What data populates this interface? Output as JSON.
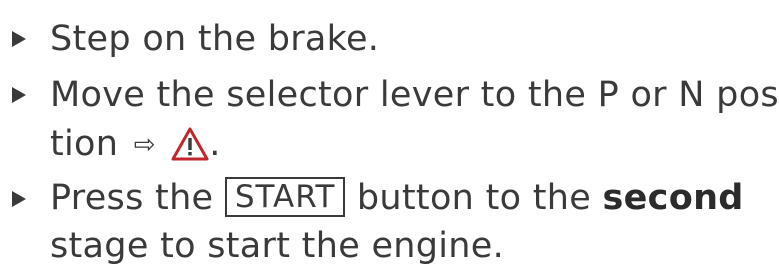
{
  "steps": [
    {
      "lines": [
        "Step on the brake."
      ]
    },
    {
      "line1": "Move the selector lever to the P or N posi-",
      "line2_text": "tion",
      "arrow_icon": "arrow-right-icon",
      "warning_icon": "warning-triangle-icon",
      "line2_end": "."
    },
    {
      "pre": "Press the",
      "key": "START",
      "mid": "button to the",
      "bold": "second",
      "line2": "stage to start the engine."
    }
  ],
  "colors": {
    "text": "#3a3a3a",
    "warning_red": "#c0262b"
  }
}
